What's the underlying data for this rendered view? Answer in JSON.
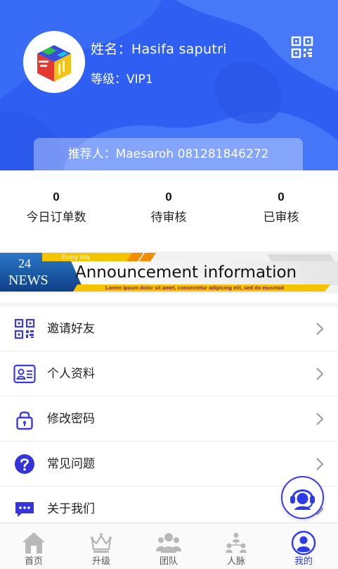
{
  "profile": {
    "name_line": "姓名：Hasifa saputri",
    "level_line": "等级：VIP1",
    "referrer_line": "推荐人：Maesaroh  081281846272"
  },
  "stats": [
    {
      "value": "0",
      "label": "今日订单数"
    },
    {
      "value": "0",
      "label": "待审核"
    },
    {
      "value": "0",
      "label": "已审核"
    }
  ],
  "banner": {
    "badge_top": "24",
    "badge_bottom": "NEWS",
    "tag": "Every day",
    "title": "Announcement information",
    "ticker": "Lorem ipsum dolor sit amet, consectetur adipicing elit, sed do eiusmod"
  },
  "menu": [
    {
      "label": "邀请好友",
      "icon": "qr-code-icon"
    },
    {
      "label": "个人资料",
      "icon": "id-card-icon"
    },
    {
      "label": "修改密码",
      "icon": "lock-icon"
    },
    {
      "label": "常见问题",
      "icon": "question-icon"
    },
    {
      "label": "关于我们",
      "icon": "chat-icon"
    }
  ],
  "tabs": [
    {
      "label": "首页",
      "icon": "home-icon",
      "active": false
    },
    {
      "label": "升级",
      "icon": "crown-icon",
      "active": false
    },
    {
      "label": "团队",
      "icon": "team-icon",
      "active": false
    },
    {
      "label": "人脉",
      "icon": "network-icon",
      "active": false
    },
    {
      "label": "我的",
      "icon": "user-icon",
      "active": true
    }
  ],
  "colors": {
    "header_blue": "#2f5ff2",
    "accent_blue": "#2d3be8",
    "banner_yellow": "#f5c400",
    "banner_orange": "#f28c00",
    "tab_inactive": "#b8b8b8"
  }
}
